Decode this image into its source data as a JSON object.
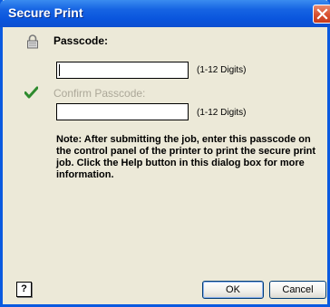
{
  "window": {
    "title": "Secure Print"
  },
  "passcode": {
    "label": "Passcode:",
    "value": "",
    "hint": "(1-12 Digits)"
  },
  "confirm": {
    "label": "Confirm Passcode:",
    "value": "",
    "hint": "(1-12 Digits)"
  },
  "note": "Note: After submitting the job, enter this passcode on the control panel of the printer to print the secure print job.  Click the Help button in this dialog box for more information.",
  "buttons": {
    "help": "?",
    "ok": "OK",
    "cancel": "Cancel"
  },
  "icons": {
    "lock": "lock-icon",
    "check": "checkmark-icon",
    "close": "close-icon"
  },
  "colors": {
    "titlebar": "#0a55dd",
    "dialog_bg": "#ece9d8",
    "check": "#2e8b2e",
    "disabled_text": "#aca899"
  }
}
